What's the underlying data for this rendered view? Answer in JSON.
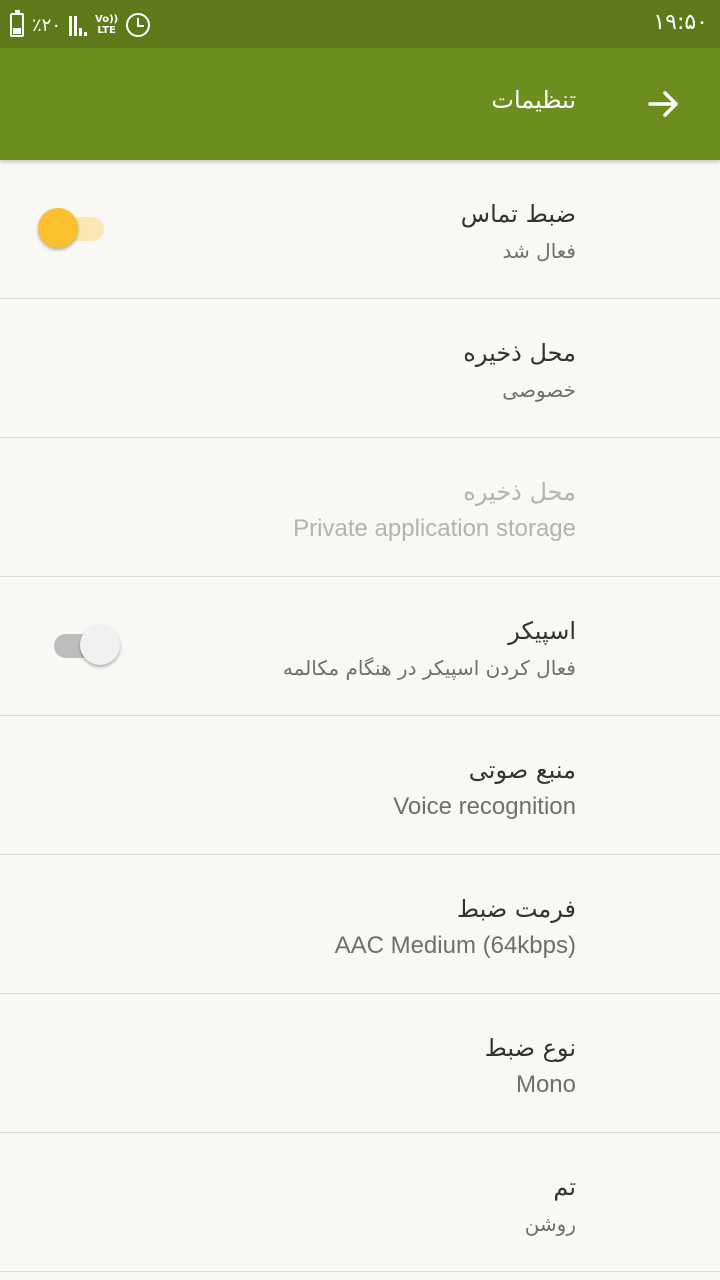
{
  "status_bar": {
    "battery_percent": "٪۲۰",
    "volte_top": "Vo))",
    "volte_bottom": "LTE",
    "time": "۱۹:۵۰"
  },
  "toolbar": {
    "title": "تنظیمات",
    "back_icon": "arrow-forward-icon"
  },
  "settings": [
    {
      "title": "ضبط تماس",
      "summary": "فعال شد",
      "switch": "on"
    },
    {
      "title": "محل ذخیره",
      "summary": "خصوصی"
    },
    {
      "title": "محل ذخیره",
      "summary": "Private application storage",
      "disabled": true
    },
    {
      "title": "اسپیکر",
      "summary": "فعال کردن اسپیکر در هنگام مکالمه",
      "switch": "off"
    },
    {
      "title": "منبع صوتی",
      "summary": "Voice recognition"
    },
    {
      "title": "فرمت ضبط",
      "summary": "AAC Medium (64kbps)"
    },
    {
      "title": "نوع ضبط",
      "summary": "Mono"
    },
    {
      "title": "تم",
      "summary": "روشن"
    }
  ],
  "colors": {
    "status_bar": "#5c7a19",
    "toolbar": "#6b8e1e",
    "switch_on": "#fbc02d",
    "background": "#f9f8f5"
  }
}
